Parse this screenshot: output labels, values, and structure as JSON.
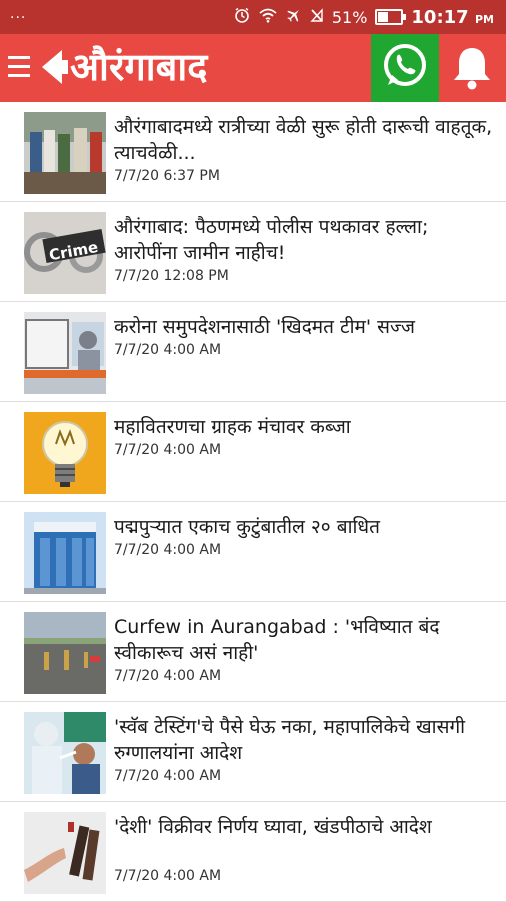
{
  "status_bar": {
    "notif": "...",
    "battery_pct_text": "51%",
    "battery_level": 0.51,
    "time": "10:17",
    "ampm": "PM",
    "icons": [
      "alarm-icon",
      "wifi-icon",
      "airplane-icon",
      "no-signal-icon",
      "battery-icon"
    ]
  },
  "appbar": {
    "title": "औरंगाबाद",
    "color": "#e84a43",
    "whatsapp_color": "#1fa731",
    "icons": [
      "menu-icon",
      "back-arrow-icon",
      "whatsapp-icon",
      "bell-icon"
    ]
  },
  "news": [
    {
      "headline": "औरंगाबादमध्ये रात्रीच्या वेळी सुरू होती दारूची वाहतूक, त्याचवेळी...",
      "time": "7/7/20 6:37 PM"
    },
    {
      "headline": "औरंगाबाद: पैठणमध्ये पोलीस पथकावर हल्ला; आरोपींना जामीन नाहीच!",
      "time": "7/7/20 12:08 PM",
      "thumb_text": "Crime"
    },
    {
      "headline": "करोना समुपदेशनासाठी 'खिदमत टीम' सज्ज",
      "time": "7/7/20 4:00 AM"
    },
    {
      "headline": "महावितरणचा ग्राहक मंचावर कब्जा",
      "time": "7/7/20 4:00 AM"
    },
    {
      "headline": "पद्मपुऱ्यात एकाच कुटुंबातील २० बाधित",
      "time": "7/7/20 4:00 AM"
    },
    {
      "headline": "Curfew in Aurangabad : 'भविष्यात बंद स्वीकारूच असं नाही'",
      "time": "7/7/20 4:00 AM"
    },
    {
      "headline": "'स्वॅब टेस्टिंग'चे पैसे घेऊ नका, महापालिकेचे खासगी रुग्णालयांना आदेश",
      "time": "7/7/20 4:00 AM"
    },
    {
      "headline": "'देशी' विक्रीवर निर्णय घ्यावा, खंडपीठाचे आदेश",
      "time": "7/7/20 4:00 AM"
    }
  ]
}
